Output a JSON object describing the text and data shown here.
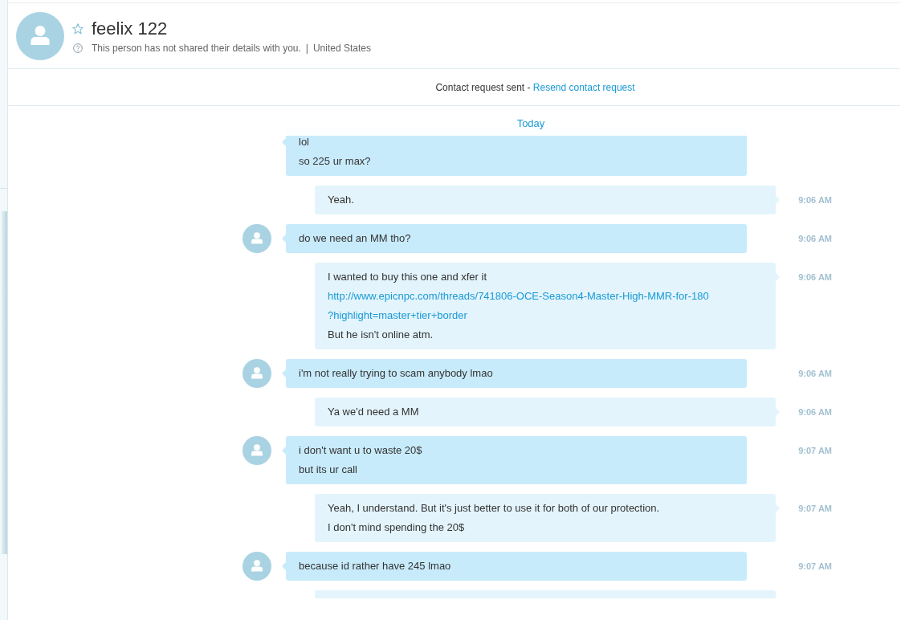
{
  "contact": {
    "name": "feelix 122",
    "favorite": false,
    "details": "This person has not shared their details with you.",
    "separator": "|",
    "location": "United States"
  },
  "request_bar": {
    "status": "Contact request sent -",
    "link": "Resend contact request"
  },
  "chat": {
    "date_label": "Today",
    "messages": [
      {
        "kind": "incoming",
        "avatar": false,
        "lines": [
          {
            "kind": "text",
            "text": "lol"
          },
          {
            "kind": "text",
            "text": "so 225 ur max?"
          }
        ]
      },
      {
        "kind": "outgoing",
        "time": "9:06 AM",
        "lines": [
          {
            "kind": "text",
            "text": "Yeah."
          }
        ]
      },
      {
        "kind": "incoming",
        "avatar": true,
        "time": "9:06 AM",
        "lines": [
          {
            "kind": "text",
            "text": "do we need an MM tho?"
          }
        ]
      },
      {
        "kind": "outgoing",
        "time": "9:06 AM",
        "lines": [
          {
            "kind": "text",
            "text": "I wanted to buy this one and xfer it"
          },
          {
            "kind": "link",
            "parts": [
              "http://www.epicnpc.com/threads/741806-OCE-Season4-Master-High-MMR-for-180",
              "?highlight=master+tier+border"
            ]
          },
          {
            "kind": "text",
            "text": "But he isn't online atm."
          }
        ]
      },
      {
        "kind": "incoming",
        "avatar": true,
        "time": "9:06 AM",
        "lines": [
          {
            "kind": "text",
            "text": "i'm not really trying to scam anybody lmao"
          }
        ]
      },
      {
        "kind": "outgoing",
        "time": "9:06 AM",
        "lines": [
          {
            "kind": "text",
            "text": "Ya we'd need a MM"
          }
        ]
      },
      {
        "kind": "incoming",
        "avatar": true,
        "time": "9:07 AM",
        "lines": [
          {
            "kind": "text",
            "text": "i don't want u to waste 20$"
          },
          {
            "kind": "text",
            "text": "but its ur call"
          }
        ]
      },
      {
        "kind": "outgoing",
        "time": "9:07 AM",
        "lines": [
          {
            "kind": "text",
            "text": "Yeah, I understand. But it's just better to use it for both of our protection."
          },
          {
            "kind": "text",
            "text": "I don't mind spending the 20$"
          }
        ]
      },
      {
        "kind": "incoming",
        "avatar": true,
        "time": "9:07 AM",
        "lines": [
          {
            "kind": "text",
            "text": "because id rather have 245 lmao"
          }
        ]
      },
      {
        "kind": "outgoing"
      }
    ]
  }
}
